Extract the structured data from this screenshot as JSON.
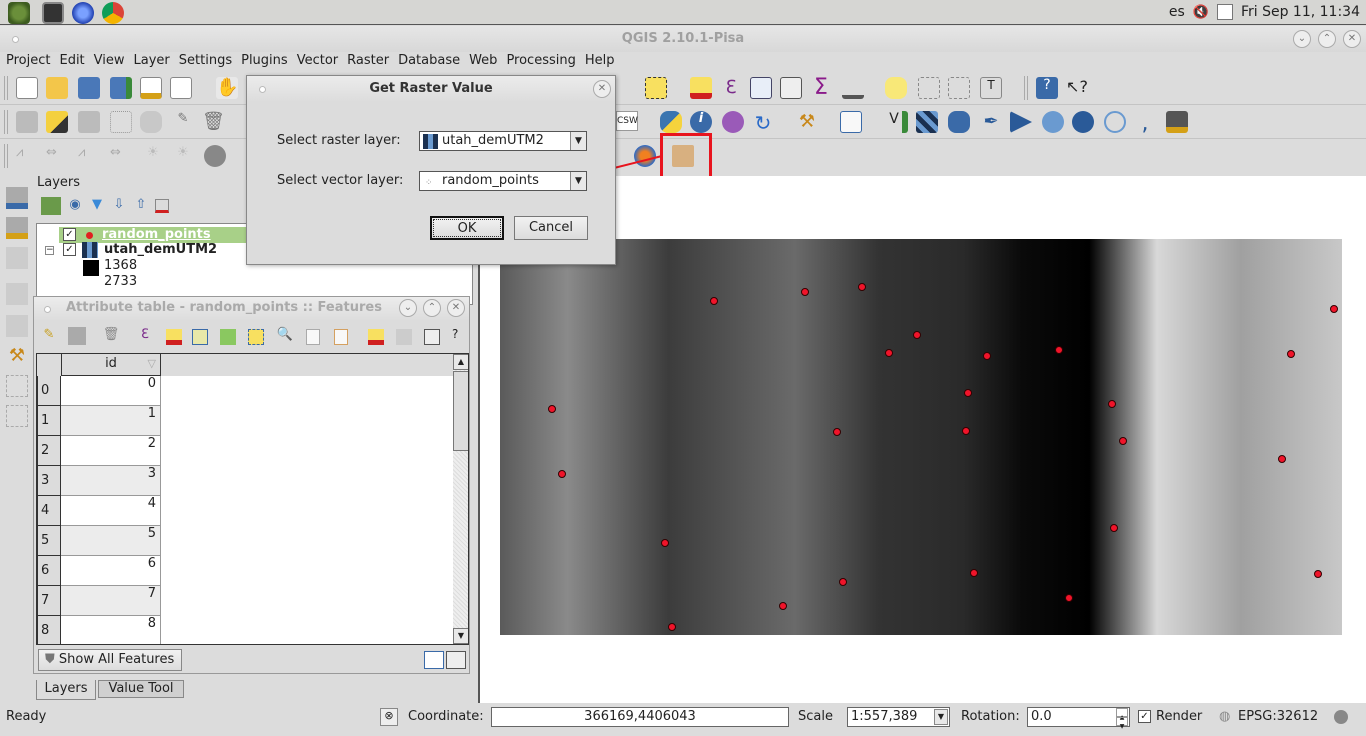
{
  "system_bar": {
    "launchers": [
      "app-menu-icon",
      "terminal-icon",
      "browser-icon",
      "chrome-icon"
    ],
    "keyboard_layout": "es",
    "clock": "Fri Sep 11, 11:34"
  },
  "window": {
    "title": "QGIS 2.10.1-Pisa"
  },
  "menubar": {
    "items": [
      "Project",
      "Edit",
      "View",
      "Layer",
      "Settings",
      "Plugins",
      "Vector",
      "Raster",
      "Database",
      "Web",
      "Processing",
      "Help"
    ]
  },
  "layers_panel": {
    "title": "Layers",
    "layers": [
      {
        "name": "random_points",
        "checked": true,
        "selected": true
      },
      {
        "name": "utah_demUTM2",
        "checked": true,
        "selected": false
      }
    ],
    "legend": [
      "1368",
      "2733"
    ]
  },
  "attribute_table": {
    "title": "Attribute table - random_points :: Features",
    "column": "id",
    "row_headers": [
      "0",
      "1",
      "2",
      "3",
      "4",
      "5",
      "6",
      "7",
      "8"
    ],
    "values": [
      "0",
      "1",
      "2",
      "3",
      "4",
      "5",
      "6",
      "7",
      "8"
    ],
    "filter_button": "Show All Features",
    "help": "?"
  },
  "dock_tabs": [
    "Layers",
    "Value Tool"
  ],
  "dialog": {
    "title": "Get Raster Value",
    "raster_label": "Select raster layer:",
    "raster_value": "utah_demUTM2",
    "vector_label": "Select vector layer:",
    "vector_value": "random_points",
    "ok": "OK",
    "cancel": "Cancel"
  },
  "toolbar": {
    "csw_label": "CSW",
    "highlight_color": "#e8141e"
  },
  "statusbar": {
    "status": "Ready",
    "coordinate_label": "Coordinate:",
    "coordinate_value": "366169,4406043",
    "scale_label": "Scale",
    "scale_value": "1:557,389",
    "rotation_label": "Rotation:",
    "rotation_value": "0.0",
    "render_label": "Render",
    "render_checked": true,
    "crs": "EPSG:32612"
  },
  "map_points_color": "#f0142a"
}
